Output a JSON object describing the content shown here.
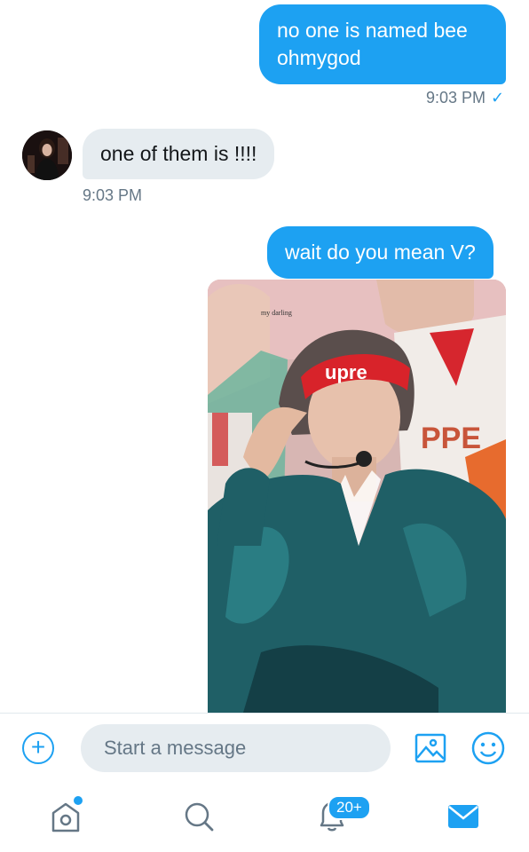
{
  "messages": [
    {
      "direction": "outgoing",
      "text": "no one is named bee ohmygod",
      "time": "9:03 PM",
      "status_icon": "checkmark-icon"
    },
    {
      "direction": "incoming",
      "text": "one of them is !!!!",
      "time": "9:03 PM"
    },
    {
      "direction": "outgoing",
      "text": "wait do you mean V?"
    },
    {
      "direction": "outgoing",
      "type": "image"
    }
  ],
  "composer": {
    "placeholder": "Start a message",
    "icons": [
      "plus-icon",
      "photo-icon",
      "emoji-icon"
    ]
  },
  "tabbar": {
    "items": [
      {
        "name": "home",
        "icon": "home-icon",
        "has_dot": true
      },
      {
        "name": "search",
        "icon": "search-icon"
      },
      {
        "name": "notifications",
        "icon": "bell-icon",
        "badge": "20+"
      },
      {
        "name": "messages",
        "icon": "mail-icon",
        "active": true
      }
    ]
  },
  "colors": {
    "accent": "#1da1f2",
    "incoming_bubble": "#e6ecf0",
    "timestamp": "#657786"
  }
}
